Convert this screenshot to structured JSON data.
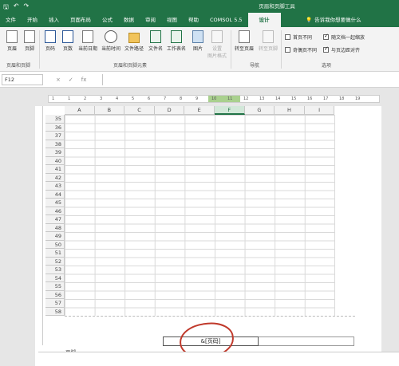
{
  "qat": {
    "save_icon": "save-icon",
    "undo_icon": "undo-icon",
    "redo_icon": "redo-icon"
  },
  "context_tab_title": "页眉和页脚工具",
  "tabs": [
    "文件",
    "开始",
    "插入",
    "页面布局",
    "公式",
    "数据",
    "审阅",
    "视图",
    "帮助",
    "COMSOL 5.5"
  ],
  "active_tab": "设计",
  "tell_me": "告诉我你想要做什么",
  "ribbon": {
    "header_btn": "页眉",
    "footer_btn": "页脚",
    "group_hf": "页眉和页脚",
    "page_number": "页码",
    "page_count": "页数",
    "current_date": "当前日期",
    "current_time": "当前时间",
    "file_path": "文件路径",
    "file_name": "文件名",
    "sheet_name": "工作表名",
    "picture": "图片",
    "format_picture_1": "设置",
    "format_picture_2": "图片格式",
    "group_elements": "页眉和页脚元素",
    "goto_header": "转至页眉",
    "goto_footer": "转至页脚",
    "group_nav": "导航",
    "opt_diff_first": "首页不同",
    "opt_diff_odd_even": "奇偶页不同",
    "opt_scale": "随文档一起缩放",
    "opt_align": "与页边距对齐",
    "group_options": "选项"
  },
  "formula_bar": {
    "name_box": "F12",
    "cancel": "×",
    "enter": "✓",
    "fx": "fx"
  },
  "ruler_numbers": [
    "1",
    "1",
    "2",
    "3",
    "4",
    "5",
    "6",
    "7",
    "8",
    "9",
    "10",
    "11",
    "12",
    "13",
    "14",
    "15",
    "16",
    "17",
    "18",
    "19"
  ],
  "columns": [
    "A",
    "B",
    "C",
    "D",
    "E",
    "F",
    "G",
    "H",
    "I"
  ],
  "selected_column": "F",
  "rows": [
    "35",
    "36",
    "37",
    "38",
    "39",
    "40",
    "41",
    "42",
    "43",
    "44",
    "45",
    "46",
    "47",
    "48",
    "49",
    "50",
    "51",
    "52",
    "53",
    "54",
    "55",
    "56",
    "57",
    "58"
  ],
  "footer": {
    "label": "页脚",
    "center_value": "&[页码]"
  },
  "colors": {
    "excel_green": "#217346",
    "annotation_red": "#c0392b"
  }
}
